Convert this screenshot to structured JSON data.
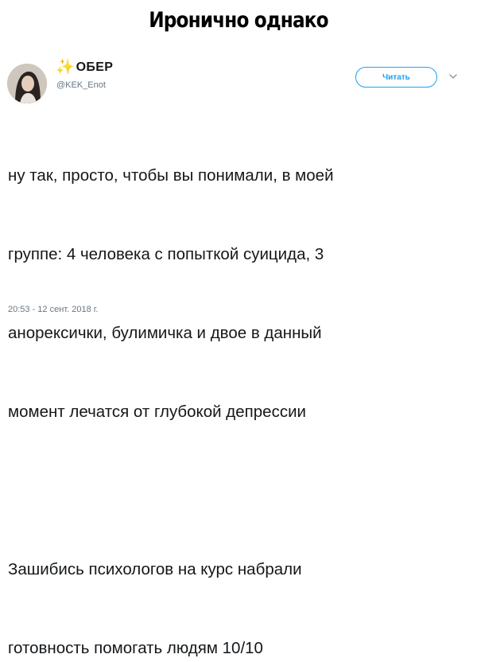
{
  "caption": "Иронично однако",
  "tweet": {
    "author": {
      "sparkle_icon": "✨",
      "display_name": "ОБЕР",
      "handle": "@KEK_Enot"
    },
    "follow_label": "Читать",
    "text_lines": [
      "ну так, просто, чтобы вы понимали, в моей",
      "группе: 4 человека с попыткой суицида, 3",
      "анорексички, булимичка и двое в данный",
      "момент лечатся от глубокой депрессии",
      "",
      "Зашибись психологов на курс набрали",
      "готовность помогать людям 10/10"
    ],
    "timestamp": "20:53 - 12 сент. 2018 г."
  },
  "colors": {
    "accent": "#1da1f2",
    "secondary_text": "#657786",
    "primary_text": "#14171a"
  },
  "icons": [
    "sparkle-icon",
    "chevron-down-icon"
  ]
}
